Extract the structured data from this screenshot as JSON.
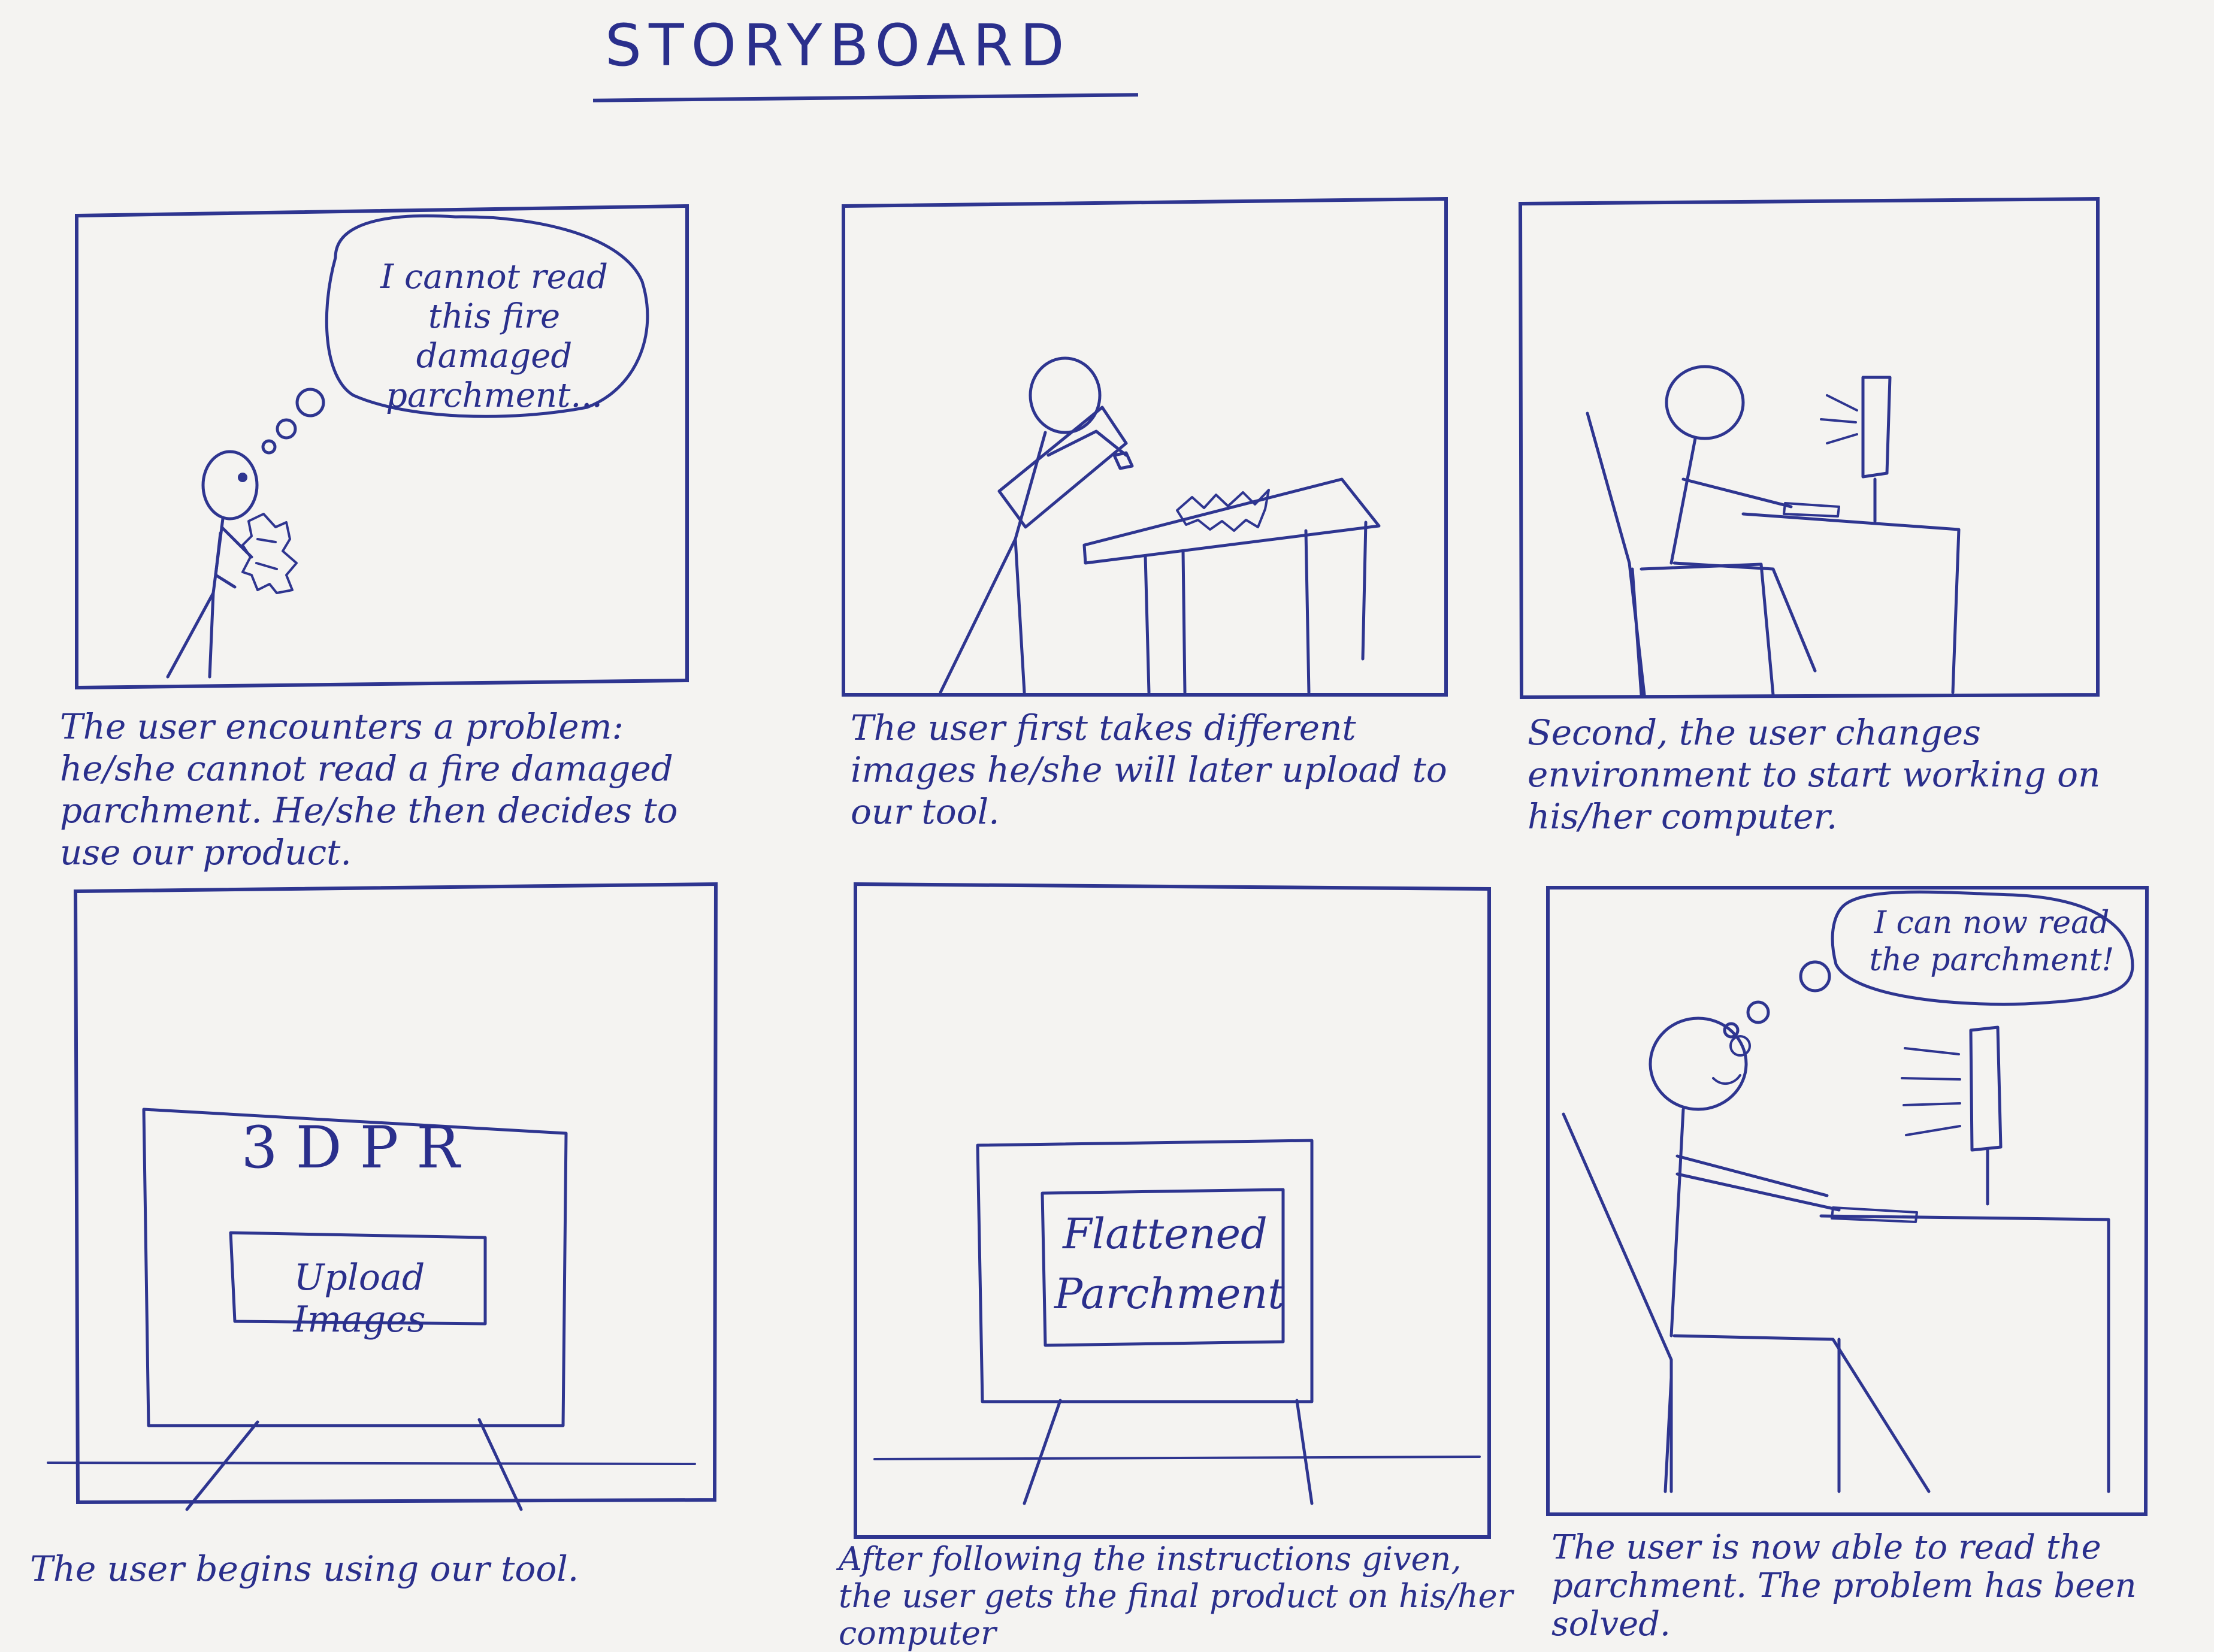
{
  "title": "STORYBOARD",
  "colors": {
    "paper": "#f4f3f1",
    "ink": "#2e3590"
  },
  "panels": [
    {
      "thought": "I cannot read this fire damaged parchment...",
      "caption": "The user encounters a problem: he/she cannot read a fire damaged parchment. He/she then decides to use our product."
    },
    {
      "caption": "The user first takes different images he/she will later upload to our tool."
    },
    {
      "caption": "Second, the user changes environment to start working on his/her computer."
    },
    {
      "screen_title": "3DPR",
      "screen_button": "Upload Images",
      "caption": "The user begins using our tool."
    },
    {
      "screen_box": "Flattened Parchment",
      "caption": "After following the instructions given, the user gets the final product on his/her computer"
    },
    {
      "thought": "I can now read the parchment!",
      "caption": "The user is now able to read the parchment. The problem has been solved."
    }
  ]
}
